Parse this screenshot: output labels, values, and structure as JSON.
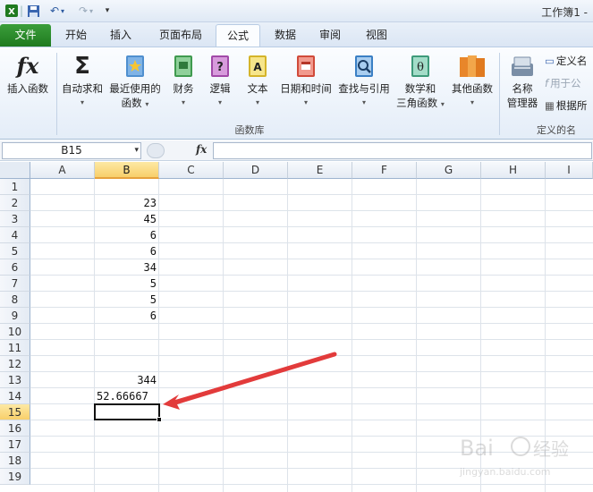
{
  "window": {
    "title": "工作簿1 -"
  },
  "tabs": [
    {
      "label": "文件"
    },
    {
      "label": "开始"
    },
    {
      "label": "插入"
    },
    {
      "label": "页面布局"
    },
    {
      "label": "公式"
    },
    {
      "label": "数据"
    },
    {
      "label": "审阅"
    },
    {
      "label": "视图"
    }
  ],
  "ribbon": {
    "insert_function": "插入函数",
    "autosum": "自动求和",
    "recent_1": "最近使用的",
    "recent_2": "函数",
    "financial": "财务",
    "logical": "逻辑",
    "text": "文本",
    "datetime": "日期和时间",
    "lookup": "查找与引用",
    "math_1": "数学和",
    "math_2": "三角函数",
    "more": "其他函数",
    "name_mgr_1": "名称",
    "name_mgr_2": "管理器",
    "define_name": "定义名",
    "use_in_formula": "用于公",
    "create_from_sel": "根据所",
    "group_library": "函数库",
    "group_names": "定义的名"
  },
  "formula_bar": {
    "name_box": "B15",
    "fx": "fx",
    "value": ""
  },
  "columns": [
    "A",
    "B",
    "C",
    "D",
    "E",
    "F",
    "G",
    "H",
    "I"
  ],
  "rows": [
    "1",
    "2",
    "3",
    "4",
    "5",
    "6",
    "7",
    "8",
    "9",
    "10",
    "11",
    "12",
    "13",
    "14",
    "15",
    "16",
    "17",
    "18",
    "19"
  ],
  "cells_b": {
    "2": "23",
    "3": "45",
    "4": "6",
    "5": "6",
    "6": "34",
    "7": "5",
    "8": "5",
    "9": "6",
    "13": "344",
    "14": "52.66667"
  },
  "selected": {
    "column": "B",
    "row": "15"
  },
  "colors": {
    "accent": "#217346",
    "arrow": "#e23b3b",
    "selection": "#f8cf6a"
  }
}
